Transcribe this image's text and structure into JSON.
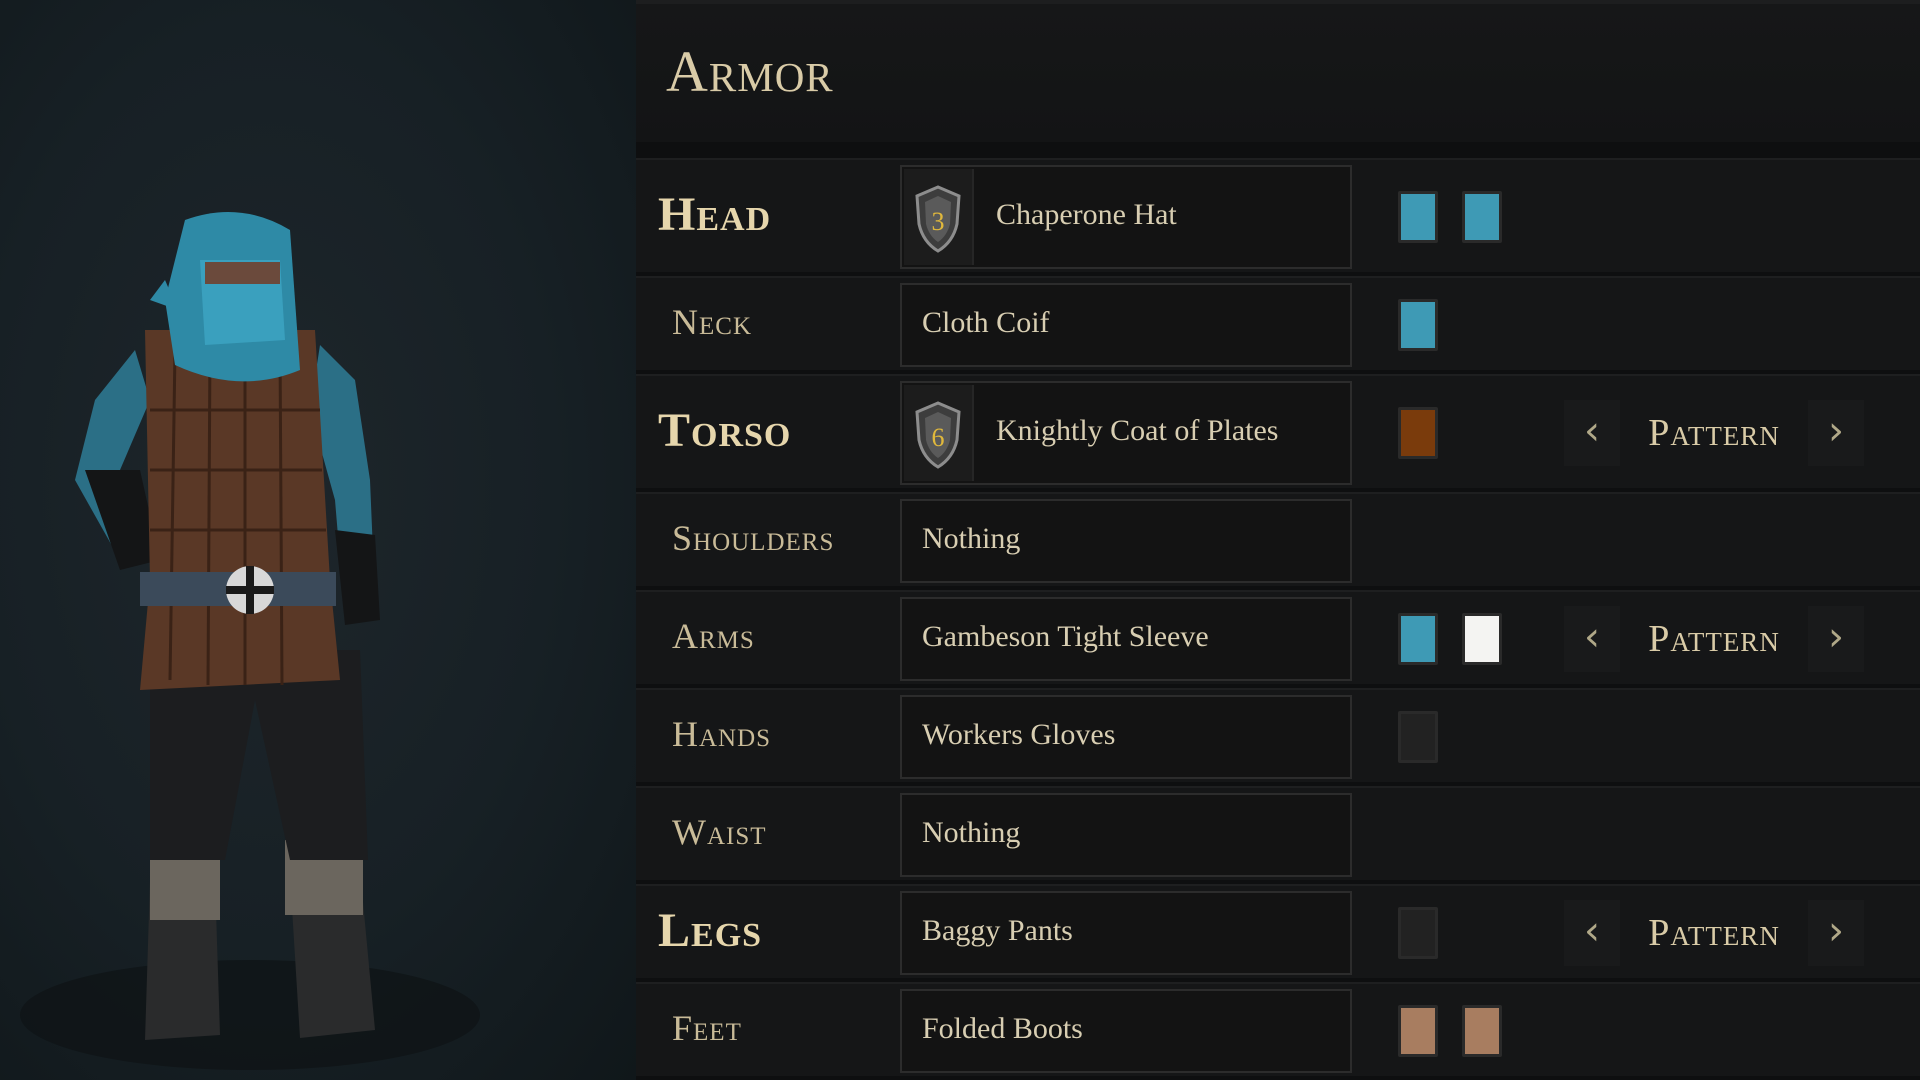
{
  "panel": {
    "title": "Armor"
  },
  "colors": {
    "teal": "#3e9ab5",
    "white": "#f4f4f2",
    "brown": "#7a3b0c",
    "dark": "#222222",
    "tan": "#a87d60"
  },
  "slots": [
    {
      "label": "Head",
      "item": "Chaperone Hat",
      "tier": "3",
      "swatches": [
        "#3e9ab5",
        "#3e9ab5"
      ],
      "pattern": ""
    },
    {
      "label": "Neck",
      "item": "Cloth Coif",
      "tier": "",
      "swatches": [
        "#3e9ab5"
      ],
      "pattern": ""
    },
    {
      "label": "Torso",
      "item": "Knightly Coat of Plates",
      "tier": "6",
      "swatches": [
        "#7a3b0c"
      ],
      "pattern": "Pattern"
    },
    {
      "label": "Shoulders",
      "item": "Nothing",
      "tier": "",
      "swatches": [],
      "pattern": ""
    },
    {
      "label": "Arms",
      "item": "Gambeson Tight Sleeve",
      "tier": "",
      "swatches": [
        "#3e9ab5",
        "#f4f4f2"
      ],
      "pattern": "Pattern"
    },
    {
      "label": "Hands",
      "item": "Workers Gloves",
      "tier": "",
      "swatches": [
        "#222222"
      ],
      "pattern": ""
    },
    {
      "label": "Waist",
      "item": "Nothing",
      "tier": "",
      "swatches": [],
      "pattern": ""
    },
    {
      "label": "Legs",
      "item": "Baggy Pants",
      "tier": "",
      "swatches": [
        "#222222"
      ],
      "pattern": "Pattern"
    },
    {
      "label": "Feet",
      "item": "Folded Boots",
      "tier": "",
      "swatches": [
        "#a87d60",
        "#a87d60"
      ],
      "pattern": ""
    }
  ],
  "icons": {
    "pattern_prev": "chevron-left-icon",
    "pattern_next": "chevron-right-icon",
    "tier": "shield-icon"
  },
  "glyphs": {
    "prev": "‹",
    "next": "›"
  }
}
